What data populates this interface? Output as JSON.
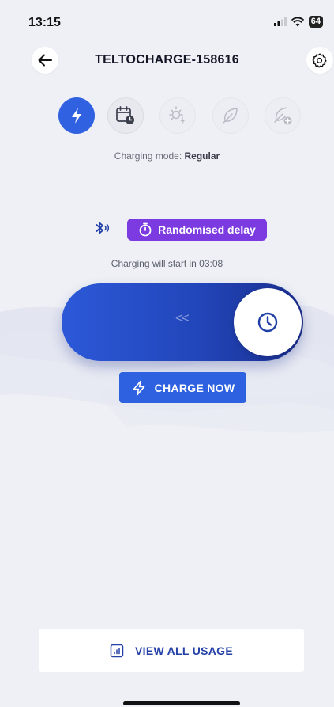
{
  "status_bar": {
    "time": "13:15",
    "battery": "64"
  },
  "header": {
    "title": "TELTOCHARGE-158616",
    "back_icon": "arrow-left-icon",
    "settings_icon": "gear-icon"
  },
  "modes": {
    "items": [
      {
        "name": "regular",
        "icon": "lightning-icon",
        "active": true
      },
      {
        "name": "scheduled",
        "icon": "calendar-clock-icon",
        "active": false
      },
      {
        "name": "solar",
        "icon": "sun-lightning-icon",
        "active": false
      },
      {
        "name": "eco",
        "icon": "leaf-icon",
        "active": false
      },
      {
        "name": "eco-plus",
        "icon": "leaf-plus-icon",
        "active": false
      }
    ],
    "label_prefix": "Charging mode:",
    "label_value": "Regular"
  },
  "delay": {
    "badge_label": "Randomised delay",
    "countdown": "Charging will start in 03:08"
  },
  "slider": {
    "chevrons": "<<"
  },
  "actions": {
    "charge_now_label": "CHARGE NOW",
    "view_usage_label": "VIEW ALL USAGE"
  },
  "colors": {
    "primary": "#2f61e0",
    "badge": "#7c3be0",
    "background": "#eef0f5",
    "slider_dark": "#1a2e8d"
  }
}
